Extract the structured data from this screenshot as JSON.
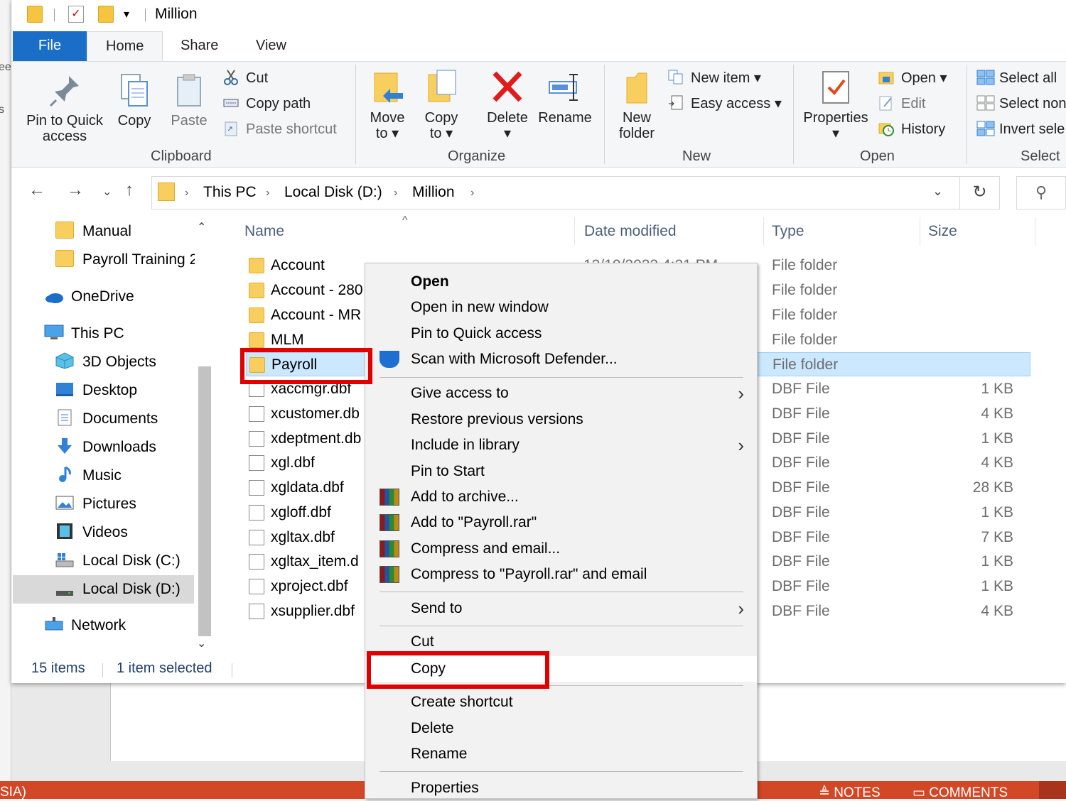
{
  "window": {
    "title": "Million"
  },
  "tabs": [
    "File",
    "Home",
    "Share",
    "View"
  ],
  "ribbon": {
    "clipboard": {
      "label": "Clipboard",
      "pin": "Pin to Quick",
      "pin2": "access",
      "copy": "Copy",
      "paste": "Paste",
      "cut": "Cut",
      "copy_path": "Copy path",
      "paste_shortcut": "Paste shortcut"
    },
    "organize": {
      "label": "Organize",
      "move": "Move",
      "move_to": "to",
      "copy": "Copy",
      "copy_to": "to",
      "delete": "Delete",
      "rename": "Rename"
    },
    "new": {
      "label": "New",
      "new_folder": "New",
      "new_folder2": "folder",
      "new_item": "New item",
      "easy_access": "Easy access"
    },
    "open": {
      "label": "Open",
      "properties": "Properties",
      "open": "Open",
      "edit": "Edit",
      "history": "History"
    },
    "select": {
      "label": "Select",
      "select_all": "Select all",
      "select_none": "Select non",
      "invert": "Invert sele"
    }
  },
  "address": {
    "crumbs": [
      "This PC",
      "Local Disk (D:)",
      "Million"
    ]
  },
  "nav": {
    "items": [
      "Manual",
      "Payroll Training 2",
      "OneDrive",
      "This PC",
      "3D Objects",
      "Desktop",
      "Documents",
      "Downloads",
      "Music",
      "Pictures",
      "Videos",
      "Local Disk (C:)",
      "Local Disk (D:)",
      "Network"
    ]
  },
  "columns": {
    "name": "Name",
    "date": "Date modified",
    "type": "Type",
    "size": "Size"
  },
  "files": [
    {
      "name": "Account",
      "type": "File folder",
      "size": "",
      "date": "12/10/2022 4:21 PM"
    },
    {
      "name": "Account - 280",
      "type": "File folder",
      "size": ""
    },
    {
      "name": "Account - MR",
      "type": "File folder",
      "size": ""
    },
    {
      "name": "MLM",
      "type": "File folder",
      "size": ""
    },
    {
      "name": "Payroll",
      "type": "File folder",
      "size": ""
    },
    {
      "name": "xaccmgr.dbf",
      "type": "DBF File",
      "size": "1 KB"
    },
    {
      "name": "xcustomer.db",
      "type": "DBF File",
      "size": "4 KB"
    },
    {
      "name": "xdeptment.db",
      "type": "DBF File",
      "size": "1 KB"
    },
    {
      "name": "xgl.dbf",
      "type": "DBF File",
      "size": "4 KB"
    },
    {
      "name": "xgldata.dbf",
      "type": "DBF File",
      "size": "28 KB"
    },
    {
      "name": "xgloff.dbf",
      "type": "DBF File",
      "size": "1 KB"
    },
    {
      "name": "xgltax.dbf",
      "type": "DBF File",
      "size": "7 KB"
    },
    {
      "name": "xgltax_item.d",
      "type": "DBF File",
      "size": "1 KB"
    },
    {
      "name": "xproject.dbf",
      "type": "DBF File",
      "size": "1 KB"
    },
    {
      "name": "xsupplier.dbf",
      "type": "DBF File",
      "size": "4 KB"
    }
  ],
  "status": {
    "count": "15 items",
    "selected": "1 item selected"
  },
  "context_menu": {
    "items": [
      "Open",
      "Open in new window",
      "Pin to Quick access",
      "Scan with Microsoft Defender...",
      "Give access to",
      "Restore previous versions",
      "Include in library",
      "Pin to Start",
      "Add to archive...",
      "Add to \"Payroll.rar\"",
      "Compress and email...",
      "Compress to \"Payroll.rar\" and email",
      "Send to",
      "Cut",
      "Copy",
      "Create shortcut",
      "Delete",
      "Rename",
      "Properties"
    ]
  },
  "background": {
    "left_fragments": [
      "ee",
      "s"
    ],
    "taskbar_left": "SIA)",
    "notes": "NOTES",
    "comments": "COMMENTS"
  },
  "colors": {
    "accent": "#1a6ec7",
    "selection": "#cce8ff",
    "highlight_box": "#e00000",
    "taskbar": "#d24726"
  }
}
